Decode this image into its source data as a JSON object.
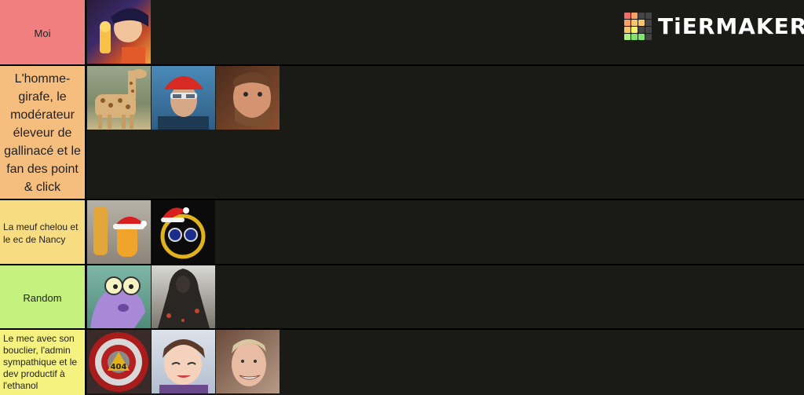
{
  "logo": {
    "text": "TiERMAKER",
    "grid_colors": [
      "#f16b6b",
      "#f6a15f",
      "#444",
      "#444",
      "#f6a15f",
      "#f6c666",
      "#f6c666",
      "#444",
      "#f6c666",
      "#f4f16c",
      "#444",
      "#444",
      "#aef17a",
      "#7fe56c",
      "#7fe56c",
      "#444"
    ]
  },
  "tiers": [
    {
      "label": "Moi",
      "color": "#f27f7f",
      "items": [
        "anime-portrait"
      ]
    },
    {
      "label": "L'homme-girafe, le modérateur éleveur de gallinacé et le fan des point & click",
      "color": "#f6be7e",
      "items": [
        "giraffe-photo",
        "man-red-cap-photo",
        "bearded-man-photo"
      ]
    },
    {
      "label": "La meuf chelou et le ec de Nancy",
      "color": "#f7dc82",
      "items": [
        "christmas-bottle-image",
        "christmas-glasses-logo"
      ]
    },
    {
      "label": "Random",
      "color": "#c5f27f",
      "items": [
        "fish-cartoon-image",
        "dark-armor-figure-image"
      ]
    },
    {
      "label": "Le mec avec son bouclier, l'admin sympathique et le dev productif à l'ethanol",
      "color": "#f6f27f",
      "items": [
        "error-404-shield-image",
        "anime-boy-image",
        "grinning-man-photo"
      ]
    }
  ]
}
